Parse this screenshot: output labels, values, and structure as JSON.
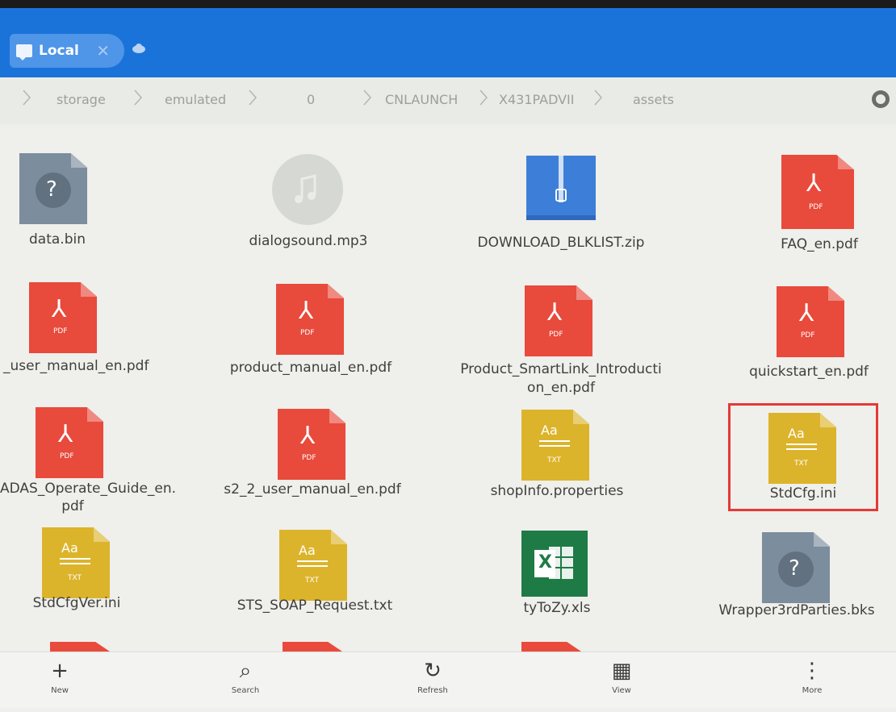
{
  "tab": {
    "label": "Local",
    "close": "✕"
  },
  "breadcrumb": [
    "storage",
    "emulated",
    "0",
    "CNLAUNCH",
    "X431PADVII",
    "assets"
  ],
  "files": [
    {
      "name": "data.bin",
      "type": "unknown",
      "icon": "unknown-file-icon"
    },
    {
      "name": "dialogsound.mp3",
      "type": "audio",
      "icon": "music-file-icon"
    },
    {
      "name": "DOWNLOAD_BLKLIST.zip",
      "type": "zip",
      "icon": "zip-file-icon"
    },
    {
      "name": "FAQ_en.pdf",
      "type": "pdf",
      "icon": "pdf-file-icon"
    },
    {
      "name": "_user_manual_en.pdf",
      "type": "pdf",
      "icon": "pdf-file-icon"
    },
    {
      "name": "product_manual_en.pdf",
      "type": "pdf",
      "icon": "pdf-file-icon"
    },
    {
      "name_line1": "Product_SmartLink_Introducti",
      "name_line2": "on_en.pdf",
      "type": "pdf",
      "icon": "pdf-file-icon"
    },
    {
      "name": "quickstart_en.pdf",
      "type": "pdf",
      "icon": "pdf-file-icon"
    },
    {
      "name_line1": "ADAS_Operate_Guide_en.",
      "name_line2": "pdf",
      "type": "pdf",
      "icon": "pdf-file-icon"
    },
    {
      "name": "s2_2_user_manual_en.pdf",
      "type": "pdf",
      "icon": "pdf-file-icon"
    },
    {
      "name": "shopInfo.properties",
      "type": "txt",
      "icon": "text-file-icon"
    },
    {
      "name": "StdCfg.ini",
      "type": "txt",
      "icon": "text-file-icon",
      "highlighted": true
    },
    {
      "name": "StdCfgVer.ini",
      "type": "txt",
      "icon": "text-file-icon"
    },
    {
      "name": "STS_SOAP_Request.txt",
      "type": "txt",
      "icon": "text-file-icon"
    },
    {
      "name": "tyToZy.xls",
      "type": "excel",
      "icon": "excel-file-icon"
    },
    {
      "name": "Wrapper3rdParties.bks",
      "type": "unknown",
      "icon": "unknown-file-icon"
    }
  ],
  "icon_badges": {
    "pdf": "PDF",
    "txt": "TXT",
    "unknown": "?",
    "excel": "X",
    "text_header": "Aa"
  },
  "bottom_bar": [
    {
      "label": "New",
      "glyph": "+",
      "icon": "plus-icon"
    },
    {
      "label": "Search",
      "glyph": "⌕",
      "icon": "search-icon"
    },
    {
      "label": "Refresh",
      "glyph": "↻",
      "icon": "refresh-icon"
    },
    {
      "label": "View",
      "glyph": "▦",
      "icon": "view-grid-icon"
    },
    {
      "label": "More",
      "glyph": "⋮",
      "icon": "more-vertical-icon"
    }
  ],
  "colors": {
    "topbar": "#1a73d9",
    "pdf": "#e84a3c",
    "txt": "#dcb42b",
    "unknown": "#7c8d9d",
    "zip": "#3d7fd8",
    "excel": "#1e7b45",
    "highlight": "#e53935"
  }
}
